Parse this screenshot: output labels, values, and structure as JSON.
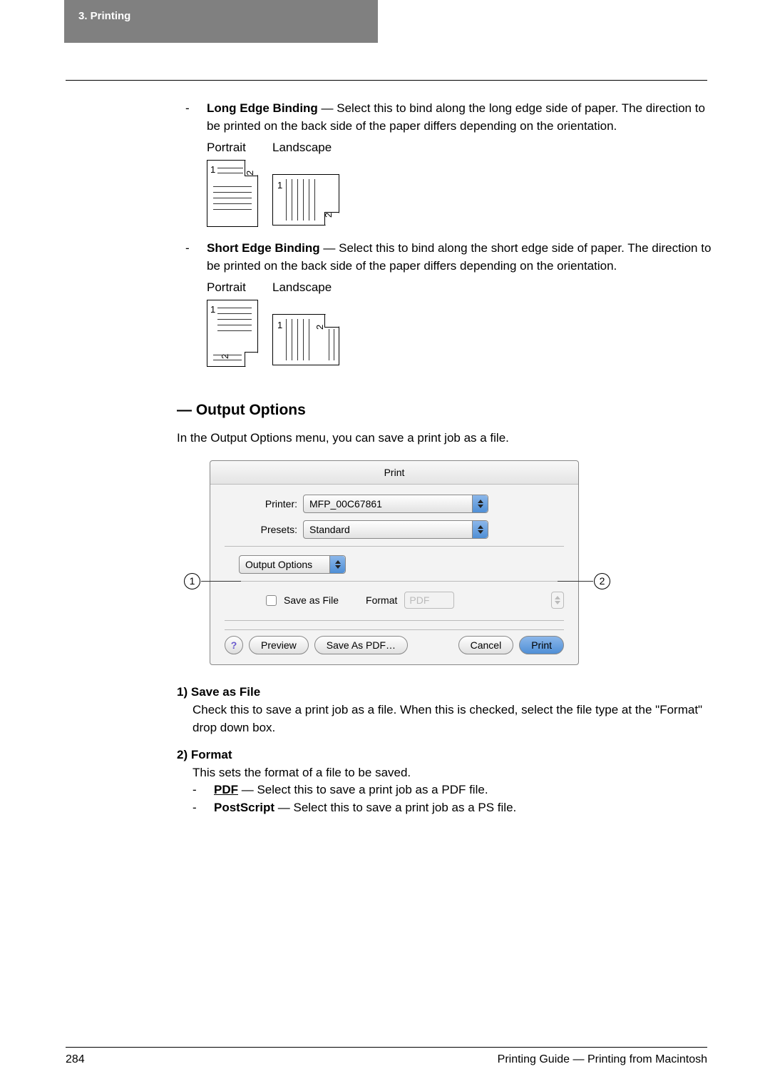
{
  "header": {
    "section": "3.  Printing"
  },
  "long_edge": {
    "title": "Long Edge Binding",
    "desc": " — Select this to bind along the long edge side of paper. The direction to be printed on the back side of the paper differs depending on the orientation.",
    "portrait": "Portrait",
    "landscape": "Landscape"
  },
  "short_edge": {
    "title": "Short Edge Binding",
    "desc": " — Select this to bind along the short edge side of paper. The direction to be printed on the back side of the paper differs depending on the orientation.",
    "portrait": "Portrait",
    "landscape": "Landscape"
  },
  "output": {
    "heading": "— Output Options",
    "intro": "In the Output Options menu, you can save a print job as a file."
  },
  "dialog": {
    "title": "Print",
    "printer_label": "Printer:",
    "printer_value": "MFP_00C67861",
    "presets_label": "Presets:",
    "presets_value": "Standard",
    "panel_select": "Output Options",
    "save_as_file": "Save as File",
    "format_label": "Format",
    "format_value": "PDF",
    "help": "?",
    "preview": "Preview",
    "save_as_pdf": "Save As PDF…",
    "cancel": "Cancel",
    "print": "Print"
  },
  "callouts": {
    "one": "1",
    "two": "2"
  },
  "list": {
    "item1_num": "1)",
    "item1_title": "Save as File",
    "item1_body": "Check this to save a print job as a file.  When this is checked, select the file type at the \"Format\" drop down box.",
    "item2_num": "2)",
    "item2_title": "Format",
    "item2_body": "This sets the format of a file to be saved.",
    "pdf_label": "PDF",
    "pdf_desc": " — Select this to save a print job as a PDF file.",
    "ps_label": "PostScript",
    "ps_desc": " — Select this to save a print job as a PS file."
  },
  "footer": {
    "page": "284",
    "right": "Printing Guide — Printing from Macintosh"
  }
}
